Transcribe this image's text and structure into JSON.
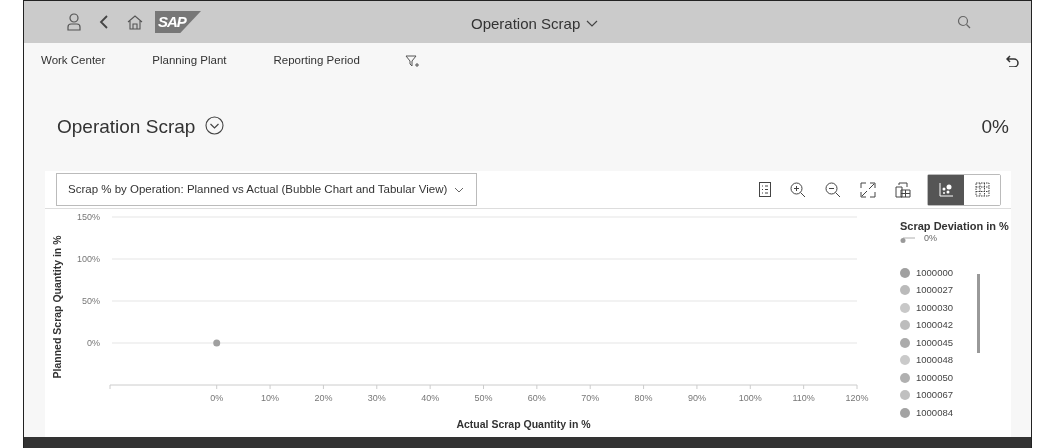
{
  "shell_bar": {
    "logo": "SAP",
    "title": "Operation Scrap"
  },
  "filter_bar": {
    "filters": [
      "Work Center",
      "Planning Plant",
      "Reporting Period"
    ]
  },
  "header": {
    "title": "Operation Scrap",
    "value": "0%"
  },
  "chart_card": {
    "view_select": "Scrap % by Operation: Planned vs Actual (Bubble Chart and Tabular View)",
    "view_toggle": [
      {
        "kind": "chart",
        "selected": true
      },
      {
        "kind": "table",
        "selected": false
      }
    ],
    "legend": {
      "size_title": "Scrap Deviation in %",
      "size_value": "0%"
    },
    "chart_data": {
      "type": "scatter",
      "grid": true,
      "xlabel": "Actual Scrap Quantity in %",
      "ylabel": "Planned Scrap Quantity in %",
      "x": [
        0
      ],
      "xlim": [
        -20,
        120
      ],
      "ylim": [
        -50,
        150
      ],
      "xticks": [
        {
          "value": 0,
          "label": "0%"
        },
        {
          "value": 10,
          "label": "10%"
        },
        {
          "value": 20,
          "label": "20%"
        },
        {
          "value": 30,
          "label": "30%"
        },
        {
          "value": 40,
          "label": "40%"
        },
        {
          "value": 50,
          "label": "50%"
        },
        {
          "value": 60,
          "label": "60%"
        },
        {
          "value": 70,
          "label": "70%"
        },
        {
          "value": 80,
          "label": "80%"
        },
        {
          "value": 90,
          "label": "90%"
        },
        {
          "value": 100,
          "label": "100%"
        },
        {
          "value": 110,
          "label": "110%"
        },
        {
          "value": 120,
          "label": "120%"
        }
      ],
      "yticks": [
        {
          "value": 0,
          "label": "0%"
        },
        {
          "value": 50,
          "label": "50%"
        },
        {
          "value": 100,
          "label": "100%"
        },
        {
          "value": 150,
          "label": "150%"
        }
      ],
      "series": [
        {
          "name": "1000000",
          "color": "#a0a0a0",
          "values": [
            0
          ]
        },
        {
          "name": "1000027",
          "color": "#bababa",
          "values": [
            null
          ]
        },
        {
          "name": "1000030",
          "color": "#c8c8c8",
          "values": [
            null
          ]
        },
        {
          "name": "1000042",
          "color": "#bdbdbd",
          "values": [
            null
          ]
        },
        {
          "name": "1000045",
          "color": "#ababab",
          "values": [
            null
          ]
        },
        {
          "name": "1000048",
          "color": "#cacaca",
          "values": [
            null
          ]
        },
        {
          "name": "1000050",
          "color": "#b0b0b0",
          "values": [
            null
          ]
        },
        {
          "name": "1000067",
          "color": "#c0c0c0",
          "values": [
            null
          ]
        },
        {
          "name": "1000084",
          "color": "#a3a3a3",
          "values": [
            null
          ]
        }
      ]
    }
  }
}
